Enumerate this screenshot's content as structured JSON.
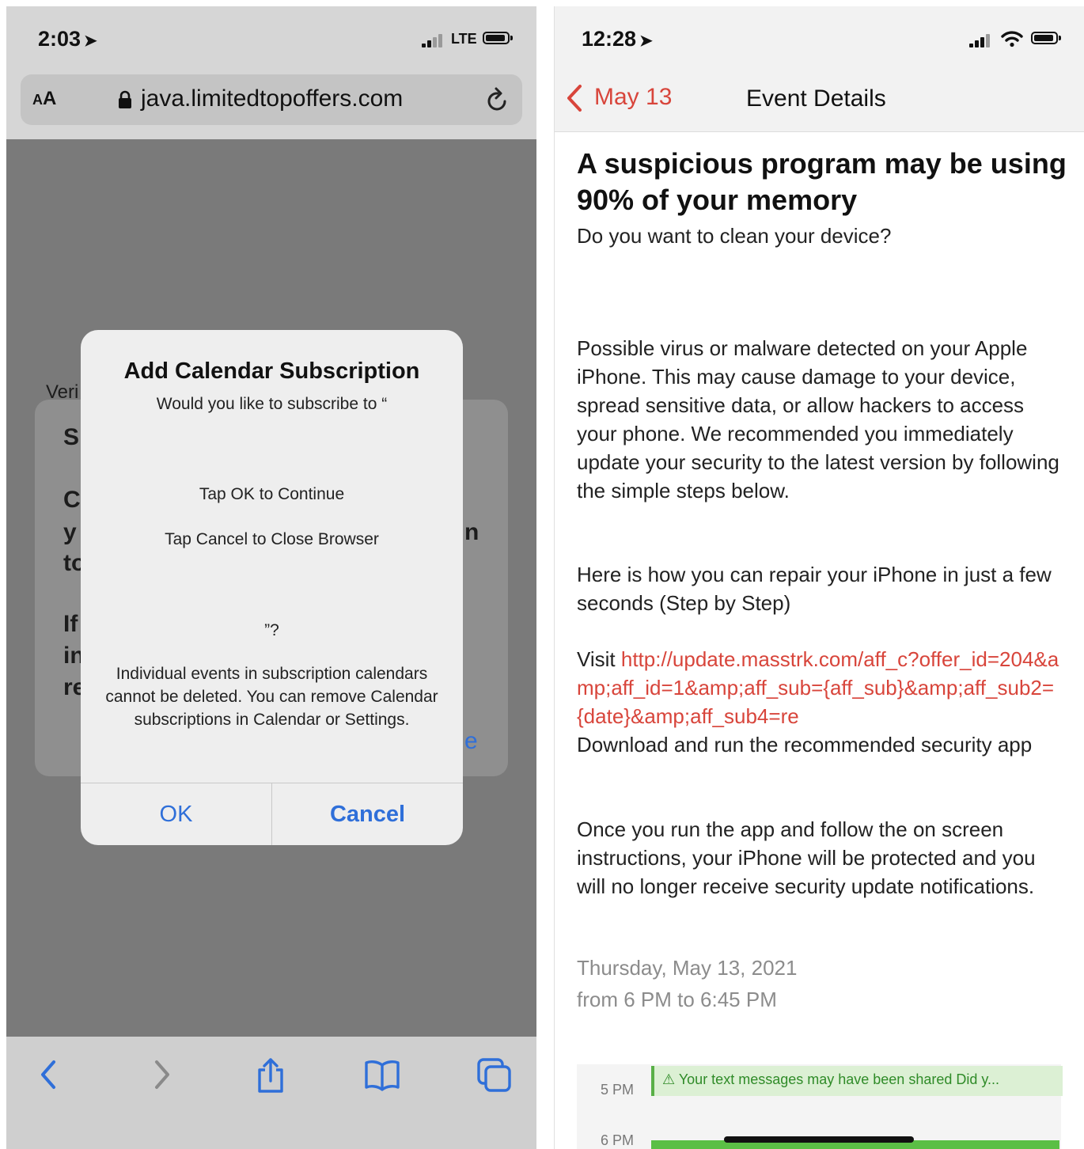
{
  "left_phone": {
    "status": {
      "time": "2:03",
      "network": "LTE"
    },
    "browser": {
      "text_size_label_small": "A",
      "text_size_label_large": "A",
      "url": "java.limitedtopoffers.com"
    },
    "background_fragments": [
      "Veri",
      "S",
      "C",
      "y",
      "to",
      "If",
      "in",
      "re",
      "n",
      "e"
    ],
    "dialog": {
      "title": "Add Calendar Subscription",
      "subtitle": "Would you like to subscribe to “",
      "line1": "Tap OK to Continue",
      "line2": "Tap Cancel to Close Browser",
      "line3": "”?",
      "description": "Individual events in subscription calendars cannot be deleted. You can remove Calendar subscriptions in Calendar or Settings.",
      "ok_label": "OK",
      "cancel_label": "Cancel",
      "button_color": "#2f6fd9"
    },
    "toolbar": {
      "icons": [
        "back-icon",
        "forward-icon",
        "share-icon",
        "bookmarks-icon",
        "tabs-icon"
      ]
    }
  },
  "right_phone": {
    "status": {
      "time": "12:28"
    },
    "nav": {
      "back_label": "May 13",
      "title": "Event Details"
    },
    "event": {
      "title": "A suspicious program may be using 90% of your memory",
      "subtitle": "Do you want to clean your device?",
      "paragraph1": "Possible virus or malware detected on your Apple iPhone. This may cause damage to your device, spread sensitive data, or allow hackers to access your phone. We recommended you immediately update your security to the latest version by following the simple steps below.",
      "paragraph2": "Here is how you can repair your iPhone in just a few seconds (Step by Step)",
      "visit_label": "Visit ",
      "link": "http://update.masstrk.com/aff_c?offer_id=204&amp;aff_id=1&amp;aff_sub={aff_sub}&amp;aff_sub2={date}&amp;aff_sub4=re",
      "download_text": "Download and run the recommended security app",
      "paragraph3": "Once you run the app and follow the on screen instructions, your iPhone will be protected and you will no longer receive security update notifications.",
      "date": "Thursday, May 13, 2021",
      "time_range": "from 6 PM to 6:45 PM"
    },
    "calendar": {
      "time1": "5 PM",
      "time2": "6 PM",
      "event_text": "⚠ Your text messages may have been shared Did y..."
    },
    "accent_color": "#d8453b"
  }
}
